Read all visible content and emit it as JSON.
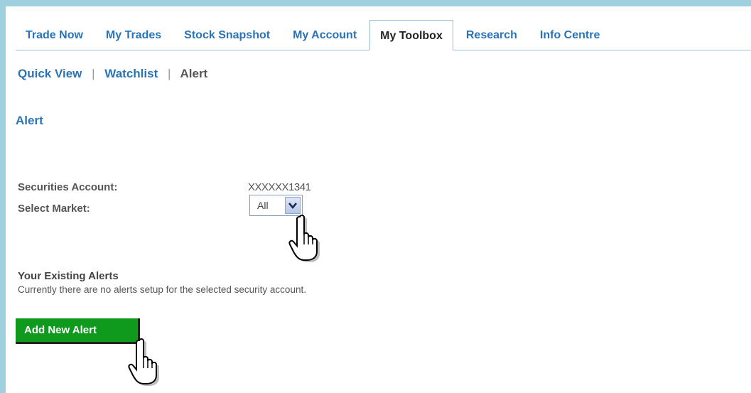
{
  "tabs": [
    {
      "label": "Trade Now"
    },
    {
      "label": "My Trades"
    },
    {
      "label": "Stock Snapshot"
    },
    {
      "label": "My Account"
    },
    {
      "label": "My Toolbox",
      "active": true
    },
    {
      "label": "Research"
    },
    {
      "label": "Info Centre"
    }
  ],
  "subnav": {
    "quick_view": "Quick View",
    "separator": "|",
    "watchlist": "Watchlist",
    "alert": "Alert"
  },
  "page_title": "Alert",
  "form": {
    "securities_account_label": "Securities Account:",
    "securities_account_value": "XXXXXX1341",
    "select_market_label": "Select Market:",
    "select_market_value": "All"
  },
  "existing_alerts": {
    "heading": "Your Existing Alerts",
    "note": "Currently there are no alerts setup for the selected security account."
  },
  "add_button_label": "Add New Alert",
  "icons": {
    "dropdown_arrow": "chevron-down-icon",
    "pointer": "hand-pointer-icon"
  },
  "colors": {
    "link_blue": "#2a74b6",
    "button_green": "#0f9a1d",
    "outer_border": "#9fd0df"
  }
}
